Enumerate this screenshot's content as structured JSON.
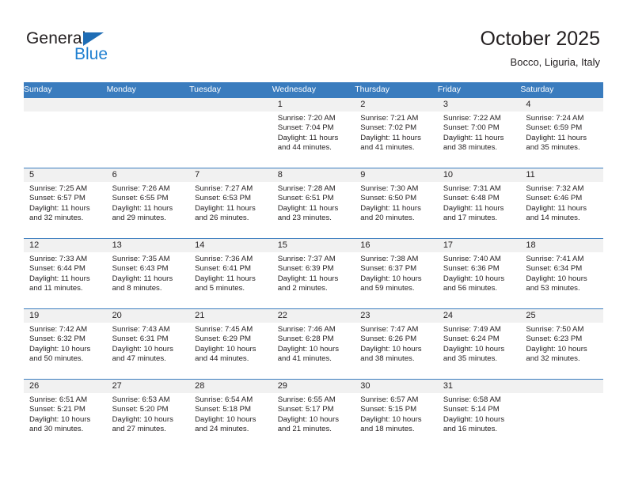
{
  "brand": {
    "name_top": "General",
    "name_bottom": "Blue",
    "triangle_icon": "triangle-icon",
    "accent_color": "#1f7fd0",
    "triangle_color": "#1f6db5"
  },
  "header": {
    "title": "October 2025",
    "subtitle": "Bocco, Liguria, Italy"
  },
  "theme": {
    "header_row_bg": "#3a7cbe",
    "date_band_bg": "#f1f1f1",
    "cell_border": "#3a7cbe",
    "text_color": "#231f20"
  },
  "calendar": {
    "weekday_headers": [
      "Sunday",
      "Monday",
      "Tuesday",
      "Wednesday",
      "Thursday",
      "Friday",
      "Saturday"
    ],
    "labels": {
      "sunrise": "Sunrise:",
      "sunset": "Sunset:",
      "daylight": "Daylight:"
    },
    "weeks": [
      [
        {
          "day": "",
          "empty": true
        },
        {
          "day": "",
          "empty": true
        },
        {
          "day": "",
          "empty": true
        },
        {
          "day": "1",
          "sunrise": "Sunrise: 7:20 AM",
          "sunset": "Sunset: 7:04 PM",
          "daylight": "Daylight: 11 hours and 44 minutes."
        },
        {
          "day": "2",
          "sunrise": "Sunrise: 7:21 AM",
          "sunset": "Sunset: 7:02 PM",
          "daylight": "Daylight: 11 hours and 41 minutes."
        },
        {
          "day": "3",
          "sunrise": "Sunrise: 7:22 AM",
          "sunset": "Sunset: 7:00 PM",
          "daylight": "Daylight: 11 hours and 38 minutes."
        },
        {
          "day": "4",
          "sunrise": "Sunrise: 7:24 AM",
          "sunset": "Sunset: 6:59 PM",
          "daylight": "Daylight: 11 hours and 35 minutes."
        }
      ],
      [
        {
          "day": "5",
          "sunrise": "Sunrise: 7:25 AM",
          "sunset": "Sunset: 6:57 PM",
          "daylight": "Daylight: 11 hours and 32 minutes."
        },
        {
          "day": "6",
          "sunrise": "Sunrise: 7:26 AM",
          "sunset": "Sunset: 6:55 PM",
          "daylight": "Daylight: 11 hours and 29 minutes."
        },
        {
          "day": "7",
          "sunrise": "Sunrise: 7:27 AM",
          "sunset": "Sunset: 6:53 PM",
          "daylight": "Daylight: 11 hours and 26 minutes."
        },
        {
          "day": "8",
          "sunrise": "Sunrise: 7:28 AM",
          "sunset": "Sunset: 6:51 PM",
          "daylight": "Daylight: 11 hours and 23 minutes."
        },
        {
          "day": "9",
          "sunrise": "Sunrise: 7:30 AM",
          "sunset": "Sunset: 6:50 PM",
          "daylight": "Daylight: 11 hours and 20 minutes."
        },
        {
          "day": "10",
          "sunrise": "Sunrise: 7:31 AM",
          "sunset": "Sunset: 6:48 PM",
          "daylight": "Daylight: 11 hours and 17 minutes."
        },
        {
          "day": "11",
          "sunrise": "Sunrise: 7:32 AM",
          "sunset": "Sunset: 6:46 PM",
          "daylight": "Daylight: 11 hours and 14 minutes."
        }
      ],
      [
        {
          "day": "12",
          "sunrise": "Sunrise: 7:33 AM",
          "sunset": "Sunset: 6:44 PM",
          "daylight": "Daylight: 11 hours and 11 minutes."
        },
        {
          "day": "13",
          "sunrise": "Sunrise: 7:35 AM",
          "sunset": "Sunset: 6:43 PM",
          "daylight": "Daylight: 11 hours and 8 minutes."
        },
        {
          "day": "14",
          "sunrise": "Sunrise: 7:36 AM",
          "sunset": "Sunset: 6:41 PM",
          "daylight": "Daylight: 11 hours and 5 minutes."
        },
        {
          "day": "15",
          "sunrise": "Sunrise: 7:37 AM",
          "sunset": "Sunset: 6:39 PM",
          "daylight": "Daylight: 11 hours and 2 minutes."
        },
        {
          "day": "16",
          "sunrise": "Sunrise: 7:38 AM",
          "sunset": "Sunset: 6:37 PM",
          "daylight": "Daylight: 10 hours and 59 minutes."
        },
        {
          "day": "17",
          "sunrise": "Sunrise: 7:40 AM",
          "sunset": "Sunset: 6:36 PM",
          "daylight": "Daylight: 10 hours and 56 minutes."
        },
        {
          "day": "18",
          "sunrise": "Sunrise: 7:41 AM",
          "sunset": "Sunset: 6:34 PM",
          "daylight": "Daylight: 10 hours and 53 minutes."
        }
      ],
      [
        {
          "day": "19",
          "sunrise": "Sunrise: 7:42 AM",
          "sunset": "Sunset: 6:32 PM",
          "daylight": "Daylight: 10 hours and 50 minutes."
        },
        {
          "day": "20",
          "sunrise": "Sunrise: 7:43 AM",
          "sunset": "Sunset: 6:31 PM",
          "daylight": "Daylight: 10 hours and 47 minutes."
        },
        {
          "day": "21",
          "sunrise": "Sunrise: 7:45 AM",
          "sunset": "Sunset: 6:29 PM",
          "daylight": "Daylight: 10 hours and 44 minutes."
        },
        {
          "day": "22",
          "sunrise": "Sunrise: 7:46 AM",
          "sunset": "Sunset: 6:28 PM",
          "daylight": "Daylight: 10 hours and 41 minutes."
        },
        {
          "day": "23",
          "sunrise": "Sunrise: 7:47 AM",
          "sunset": "Sunset: 6:26 PM",
          "daylight": "Daylight: 10 hours and 38 minutes."
        },
        {
          "day": "24",
          "sunrise": "Sunrise: 7:49 AM",
          "sunset": "Sunset: 6:24 PM",
          "daylight": "Daylight: 10 hours and 35 minutes."
        },
        {
          "day": "25",
          "sunrise": "Sunrise: 7:50 AM",
          "sunset": "Sunset: 6:23 PM",
          "daylight": "Daylight: 10 hours and 32 minutes."
        }
      ],
      [
        {
          "day": "26",
          "sunrise": "Sunrise: 6:51 AM",
          "sunset": "Sunset: 5:21 PM",
          "daylight": "Daylight: 10 hours and 30 minutes."
        },
        {
          "day": "27",
          "sunrise": "Sunrise: 6:53 AM",
          "sunset": "Sunset: 5:20 PM",
          "daylight": "Daylight: 10 hours and 27 minutes."
        },
        {
          "day": "28",
          "sunrise": "Sunrise: 6:54 AM",
          "sunset": "Sunset: 5:18 PM",
          "daylight": "Daylight: 10 hours and 24 minutes."
        },
        {
          "day": "29",
          "sunrise": "Sunrise: 6:55 AM",
          "sunset": "Sunset: 5:17 PM",
          "daylight": "Daylight: 10 hours and 21 minutes."
        },
        {
          "day": "30",
          "sunrise": "Sunrise: 6:57 AM",
          "sunset": "Sunset: 5:15 PM",
          "daylight": "Daylight: 10 hours and 18 minutes."
        },
        {
          "day": "31",
          "sunrise": "Sunrise: 6:58 AM",
          "sunset": "Sunset: 5:14 PM",
          "daylight": "Daylight: 10 hours and 16 minutes."
        },
        {
          "day": "",
          "empty": true
        }
      ]
    ]
  }
}
